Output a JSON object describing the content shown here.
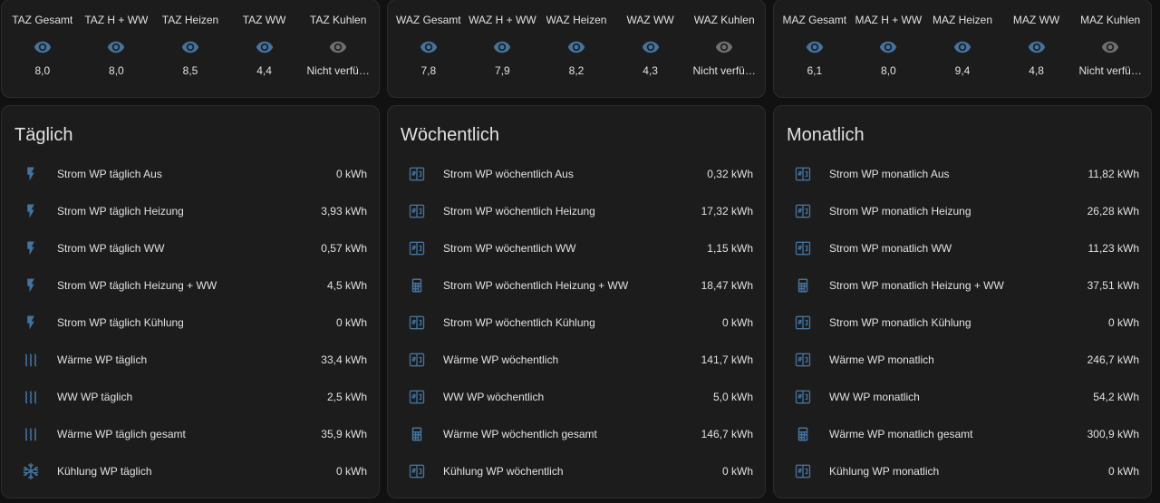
{
  "colors": {
    "icon": "#44739e",
    "icon_unavailable": "#6f6f6f",
    "card_bg": "#1c1c1c",
    "page_bg": "#111111",
    "text": "#e1e1e1"
  },
  "glance_cards": [
    {
      "items": [
        {
          "name": "TAZ Gesamt",
          "value": "8,0",
          "icon": "eye-icon",
          "available": true
        },
        {
          "name": "TAZ H + WW",
          "value": "8,0",
          "icon": "eye-icon",
          "available": true
        },
        {
          "name": "TAZ Heizen",
          "value": "8,5",
          "icon": "eye-icon",
          "available": true
        },
        {
          "name": "TAZ WW",
          "value": "4,4",
          "icon": "eye-icon",
          "available": true
        },
        {
          "name": "TAZ Kuhlen",
          "value": "Nicht verfü…",
          "icon": "eye-icon",
          "available": false
        }
      ]
    },
    {
      "items": [
        {
          "name": "WAZ Gesamt",
          "value": "7,8",
          "icon": "eye-icon",
          "available": true
        },
        {
          "name": "WAZ H + WW",
          "value": "7,9",
          "icon": "eye-icon",
          "available": true
        },
        {
          "name": "WAZ Heizen",
          "value": "8,2",
          "icon": "eye-icon",
          "available": true
        },
        {
          "name": "WAZ WW",
          "value": "4,3",
          "icon": "eye-icon",
          "available": true
        },
        {
          "name": "WAZ Kuhlen",
          "value": "Nicht verfü…",
          "icon": "eye-icon",
          "available": false
        }
      ]
    },
    {
      "items": [
        {
          "name": "MAZ Gesamt",
          "value": "6,1",
          "icon": "eye-icon",
          "available": true
        },
        {
          "name": "MAZ H + WW",
          "value": "8,0",
          "icon": "eye-icon",
          "available": true
        },
        {
          "name": "MAZ Heizen",
          "value": "9,4",
          "icon": "eye-icon",
          "available": true
        },
        {
          "name": "MAZ WW",
          "value": "4,8",
          "icon": "eye-icon",
          "available": true
        },
        {
          "name": "MAZ Kuhlen",
          "value": "Nicht verfü…",
          "icon": "eye-icon",
          "available": false
        }
      ]
    }
  ],
  "entity_cards": [
    {
      "title": "Täglich",
      "rows": [
        {
          "name": "Strom WP täglich Aus",
          "value": "0 kWh",
          "icon": "flash-icon"
        },
        {
          "name": "Strom WP täglich Heizung",
          "value": "3,93 kWh",
          "icon": "flash-icon"
        },
        {
          "name": "Strom WP täglich WW",
          "value": "0,57 kWh",
          "icon": "flash-icon"
        },
        {
          "name": "Strom WP täglich Heizung + WW",
          "value": "4,5 kWh",
          "icon": "flash-icon"
        },
        {
          "name": "Strom WP täglich Kühlung",
          "value": "0 kWh",
          "icon": "flash-icon"
        },
        {
          "name": "Wärme WP täglich",
          "value": "33,4 kWh",
          "icon": "heat-wave-icon"
        },
        {
          "name": "WW WP täglich",
          "value": "2,5 kWh",
          "icon": "heat-wave-icon"
        },
        {
          "name": "Wärme WP täglich gesamt",
          "value": "35,9 kWh",
          "icon": "heat-wave-icon"
        },
        {
          "name": "Kühlung WP täglich",
          "value": "0 kWh",
          "icon": "snowflake-icon"
        }
      ]
    },
    {
      "title": "Wöchentlich",
      "rows": [
        {
          "name": "Strom WP wöchentlich Aus",
          "value": "0,32 kWh",
          "icon": "counter-icon"
        },
        {
          "name": "Strom WP wöchentlich Heizung",
          "value": "17,32 kWh",
          "icon": "counter-icon"
        },
        {
          "name": "Strom WP wöchentlich WW",
          "value": "1,15 kWh",
          "icon": "counter-icon"
        },
        {
          "name": "Strom WP wöchentlich Heizung + WW",
          "value": "18,47 kWh",
          "icon": "calculator-icon"
        },
        {
          "name": "Strom WP wöchentlich Kühlung",
          "value": "0 kWh",
          "icon": "counter-icon"
        },
        {
          "name": "Wärme WP wöchentlich",
          "value": "141,7 kWh",
          "icon": "counter-icon"
        },
        {
          "name": "WW WP wöchentlich",
          "value": "5,0 kWh",
          "icon": "counter-icon"
        },
        {
          "name": "Wärme WP wöchentlich gesamt",
          "value": "146,7 kWh",
          "icon": "calculator-icon"
        },
        {
          "name": "Kühlung WP wöchentlich",
          "value": "0 kWh",
          "icon": "counter-icon"
        }
      ]
    },
    {
      "title": "Monatlich",
      "rows": [
        {
          "name": "Strom WP monatlich Aus",
          "value": "11,82 kWh",
          "icon": "counter-icon"
        },
        {
          "name": "Strom WP monatlich Heizung",
          "value": "26,28 kWh",
          "icon": "counter-icon"
        },
        {
          "name": "Strom WP monatlich WW",
          "value": "11,23 kWh",
          "icon": "counter-icon"
        },
        {
          "name": "Strom WP monatlich Heizung + WW",
          "value": "37,51 kWh",
          "icon": "calculator-icon"
        },
        {
          "name": "Strom WP monatlich Kühlung",
          "value": "0 kWh",
          "icon": "counter-icon"
        },
        {
          "name": "Wärme WP monatlich",
          "value": "246,7 kWh",
          "icon": "counter-icon"
        },
        {
          "name": "WW WP monatlich",
          "value": "54,2 kWh",
          "icon": "counter-icon"
        },
        {
          "name": "Wärme WP monatlich gesamt",
          "value": "300,9 kWh",
          "icon": "calculator-icon"
        },
        {
          "name": "Kühlung WP monatlich",
          "value": "0 kWh",
          "icon": "counter-icon"
        }
      ]
    }
  ]
}
